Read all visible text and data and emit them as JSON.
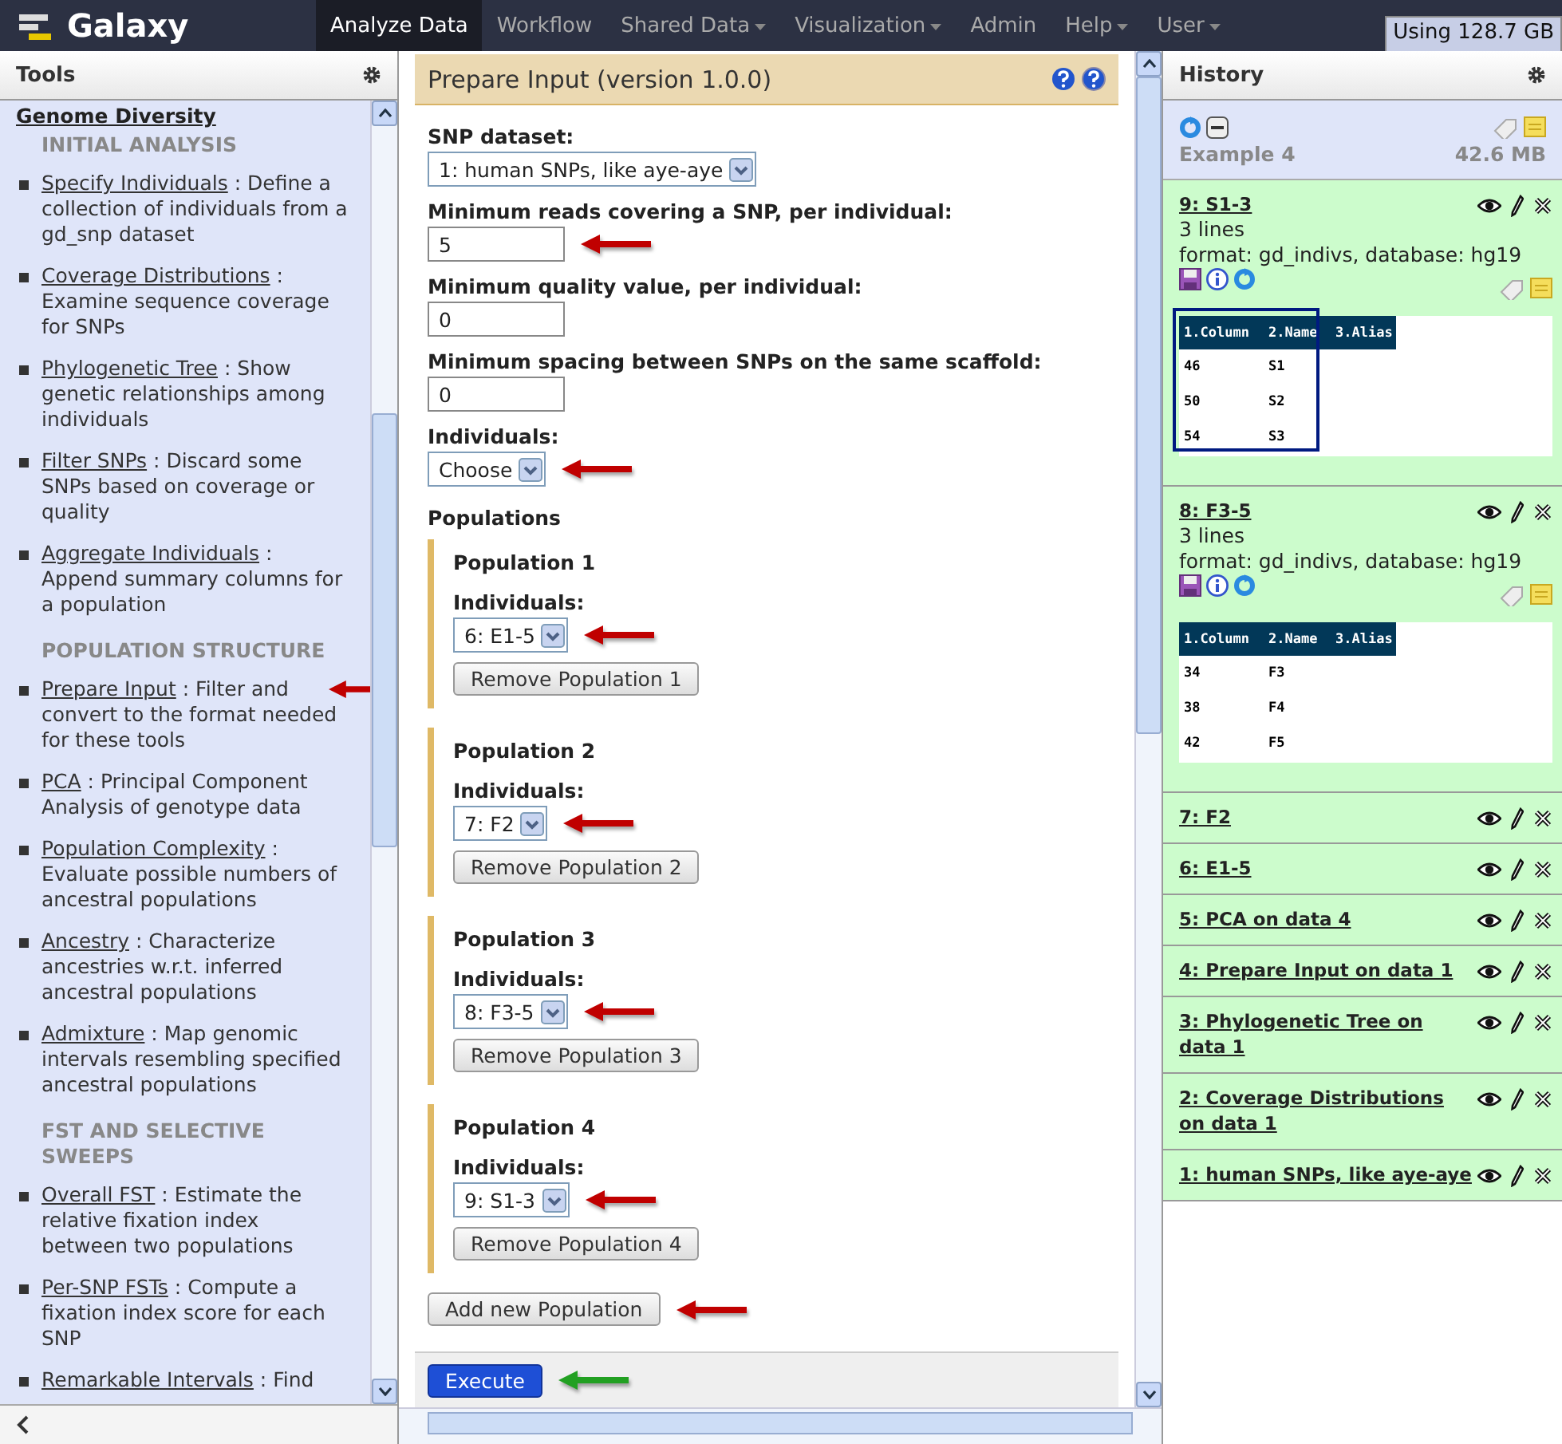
{
  "masthead": {
    "brand": "Galaxy",
    "tabs": [
      {
        "label": "Analyze Data",
        "selected": true,
        "menu": false
      },
      {
        "label": "Workflow",
        "selected": false,
        "menu": false
      },
      {
        "label": "Shared Data",
        "selected": false,
        "menu": true
      },
      {
        "label": "Visualization",
        "selected": false,
        "menu": true
      },
      {
        "label": "Admin",
        "selected": false,
        "menu": false
      },
      {
        "label": "Help",
        "selected": false,
        "menu": true
      },
      {
        "label": "User",
        "selected": false,
        "menu": true
      }
    ],
    "usage": "Using 128.7 GB"
  },
  "tools": {
    "title": "Tools",
    "section": "Genome Diversity",
    "groups": [
      {
        "label": "INITIAL ANALYSIS",
        "tools": [
          {
            "name": "Specify Individuals",
            "description": ": Define a collection of individuals from a gd_snp dataset",
            "arrow": false
          },
          {
            "name": "Coverage Distributions",
            "description": ": Examine sequence coverage for SNPs",
            "arrow": false
          },
          {
            "name": "Phylogenetic Tree",
            "description": ": Show genetic relationships among individuals",
            "arrow": false
          },
          {
            "name": "Filter SNPs",
            "description": ": Discard some SNPs based on coverage or quality",
            "arrow": false
          },
          {
            "name": "Aggregate Individuals",
            "description": ": Append summary columns for a population",
            "arrow": false
          }
        ]
      },
      {
        "label": "POPULATION STRUCTURE",
        "tools": [
          {
            "name": "Prepare Input",
            "description": ": Filter and convert to the format needed for these tools",
            "arrow": true
          },
          {
            "name": "PCA",
            "description": ": Principal Component Analysis of genotype data",
            "arrow": false
          },
          {
            "name": "Population Complexity",
            "description": ": Evaluate possible numbers of ancestral populations",
            "arrow": false
          },
          {
            "name": "Ancestry",
            "description": ": Characterize ancestries w.r.t. inferred ancestral populations",
            "arrow": false
          },
          {
            "name": "Admixture",
            "description": ": Map genomic intervals resembling specified ancestral populations",
            "arrow": false
          }
        ]
      },
      {
        "label": "FST AND SELECTIVE SWEEPS",
        "tools": [
          {
            "name": "Overall FST",
            "description": ": Estimate the relative fixation index between two populations",
            "arrow": false
          },
          {
            "name": "Per-SNP FSTs",
            "description": ": Compute a fixation index score for each SNP",
            "arrow": false
          },
          {
            "name": "Remarkable Intervals",
            "description": ": Find",
            "arrow": false
          }
        ]
      }
    ]
  },
  "form": {
    "title": "Prepare Input (version 1.0.0)",
    "fields": [
      {
        "kind": "select",
        "label": "SNP dataset:",
        "value": "1: human SNPs, like aye-aye",
        "arrow": false
      },
      {
        "kind": "text",
        "label": "Minimum reads covering a SNP, per individual:",
        "value": "5",
        "arrow": true
      },
      {
        "kind": "text",
        "label": "Minimum quality value, per individual:",
        "value": "0",
        "arrow": false
      },
      {
        "kind": "text",
        "label": "Minimum spacing between SNPs on the same scaffold:",
        "value": "0",
        "arrow": false
      },
      {
        "kind": "select",
        "label": "Individuals:",
        "value": "Choose",
        "arrow": true
      }
    ],
    "populations_label": "Populations",
    "populations": [
      {
        "title": "Population 1",
        "label": "Individuals:",
        "value": "6: E1-5",
        "remove": "Remove Population 1",
        "arrow": true
      },
      {
        "title": "Population 2",
        "label": "Individuals:",
        "value": "7: F2",
        "remove": "Remove Population 2",
        "arrow": true
      },
      {
        "title": "Population 3",
        "label": "Individuals:",
        "value": "8: F3-5",
        "remove": "Remove Population 3",
        "arrow": true
      },
      {
        "title": "Population 4",
        "label": "Individuals:",
        "value": "9: S1-3",
        "remove": "Remove Population 4",
        "arrow": true
      }
    ],
    "add_button": {
      "label": "Add new Population",
      "arrow": true
    },
    "execute": {
      "label": "Execute",
      "arrow": true
    }
  },
  "history": {
    "title": "History",
    "name": "Example 4",
    "size": "42.6 MB",
    "items": [
      {
        "title": "9: S1-3",
        "expanded": true,
        "summary": "3 lines",
        "info": "format: gd_indivs, database: hg19",
        "peek": {
          "columns": [
            "1.Column",
            "2.Name",
            "3.Alias"
          ],
          "rows": [
            [
              "46",
              "S1"
            ],
            [
              "50",
              "S2"
            ],
            [
              "54",
              "S3"
            ]
          ],
          "highlight": true
        }
      },
      {
        "title": "8: F3-5",
        "expanded": true,
        "summary": "3 lines",
        "info": "format: gd_indivs, database: hg19",
        "peek": {
          "columns": [
            "1.Column",
            "2.Name",
            "3.Alias"
          ],
          "rows": [
            [
              "34",
              "F3"
            ],
            [
              "38",
              "F4"
            ],
            [
              "42",
              "F5"
            ]
          ],
          "highlight": false
        }
      },
      {
        "title": "7: F2",
        "expanded": false
      },
      {
        "title": "6: E1-5",
        "expanded": false
      },
      {
        "title": "5: PCA on data 4",
        "expanded": false
      },
      {
        "title": "4: Prepare Input on data 1",
        "expanded": false
      },
      {
        "title": "3: Phylogenetic Tree on data 1",
        "expanded": false
      },
      {
        "title": "2: Coverage Distributions on data 1",
        "expanded": false
      },
      {
        "title": "1: human SNPs, like aye-aye",
        "expanded": false
      }
    ]
  }
}
